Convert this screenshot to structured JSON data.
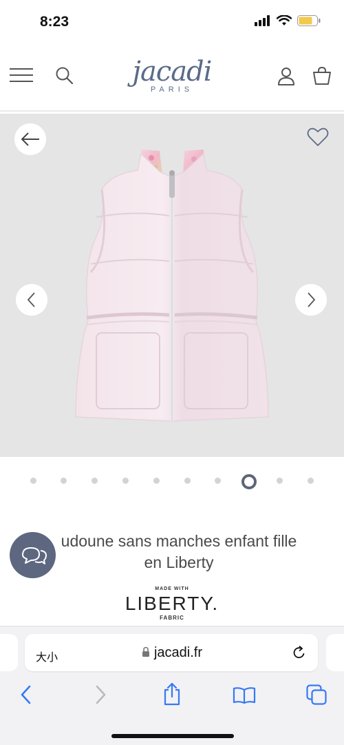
{
  "status_bar": {
    "time": "8:23"
  },
  "header": {
    "logo_main": "jacadi",
    "logo_sub": "PARIS"
  },
  "gallery": {
    "dot_count": 10,
    "active_index": 7
  },
  "product": {
    "title_line1": "udoune sans manches enfant fille",
    "title_line2": "en Liberty",
    "made_with": "MADE WITH",
    "brand": "LIBERTY.",
    "brand_sub": "FABRIC"
  },
  "safari": {
    "text_size": "大小",
    "url": "jacadi.fr"
  },
  "colors": {
    "brand": "#5a6b86",
    "safari_blue": "#3478f6",
    "chat": "#5d6780"
  }
}
